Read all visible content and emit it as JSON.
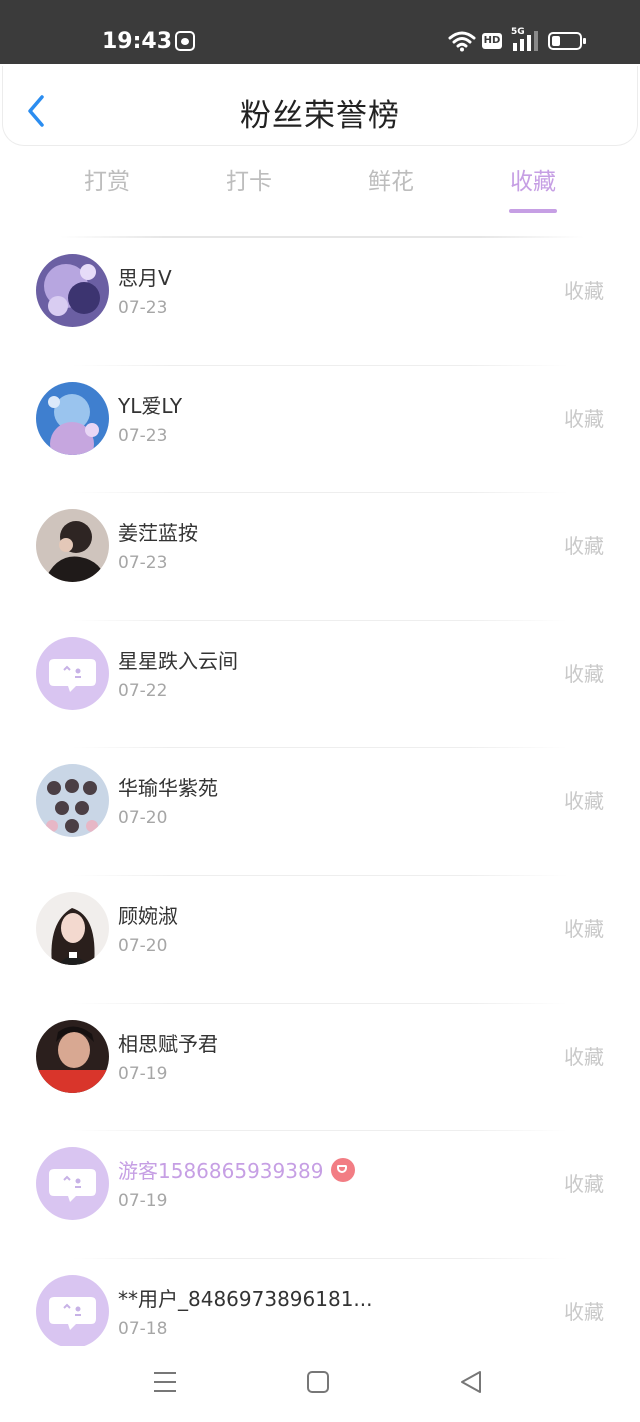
{
  "status_bar": {
    "time": "19:43",
    "app_icon": "baidu-paw-icon",
    "hd_label": "HD",
    "network_label": "5G",
    "battery_level": 0.3
  },
  "header": {
    "title": "粉丝荣誉榜",
    "back_icon": "chevron-left-icon"
  },
  "tabs": [
    {
      "label": "打赏",
      "active": false
    },
    {
      "label": "打卡",
      "active": false
    },
    {
      "label": "鲜花",
      "active": false
    },
    {
      "label": "收藏",
      "active": true
    }
  ],
  "colors": {
    "accent": "#c69fe4",
    "vip_badge": "#f27d84",
    "default_avatar": "#d9c5f1"
  },
  "entries": [
    {
      "name": "思月V",
      "date": "07-23",
      "type": "收藏",
      "avatar": "photo-fantasy"
    },
    {
      "name": "YL爱LY",
      "date": "07-23",
      "type": "收藏",
      "avatar": "photo-blue-girl"
    },
    {
      "name": "姜茳蓝按",
      "date": "07-23",
      "type": "收藏",
      "avatar": "photo-dark"
    },
    {
      "name": "星星跌入云间",
      "date": "07-22",
      "type": "收藏",
      "avatar": "default-chat"
    },
    {
      "name": "华瑜华紫苑",
      "date": "07-20",
      "type": "收藏",
      "avatar": "photo-group"
    },
    {
      "name": "顾婉淑",
      "date": "07-20",
      "type": "收藏",
      "avatar": "photo-portrait"
    },
    {
      "name": "相思赋予君",
      "date": "07-19",
      "type": "收藏",
      "avatar": "photo-red"
    },
    {
      "name": "游客1586865939389",
      "date": "07-19",
      "type": "收藏",
      "avatar": "default-chat",
      "vip": true
    },
    {
      "name": "**用户_8486973896181...",
      "date": "07-18",
      "type": "收藏",
      "avatar": "default-chat"
    }
  ],
  "nav_bar": {
    "icons": [
      "menu-icon",
      "home-icon",
      "back-triangle-icon"
    ]
  }
}
